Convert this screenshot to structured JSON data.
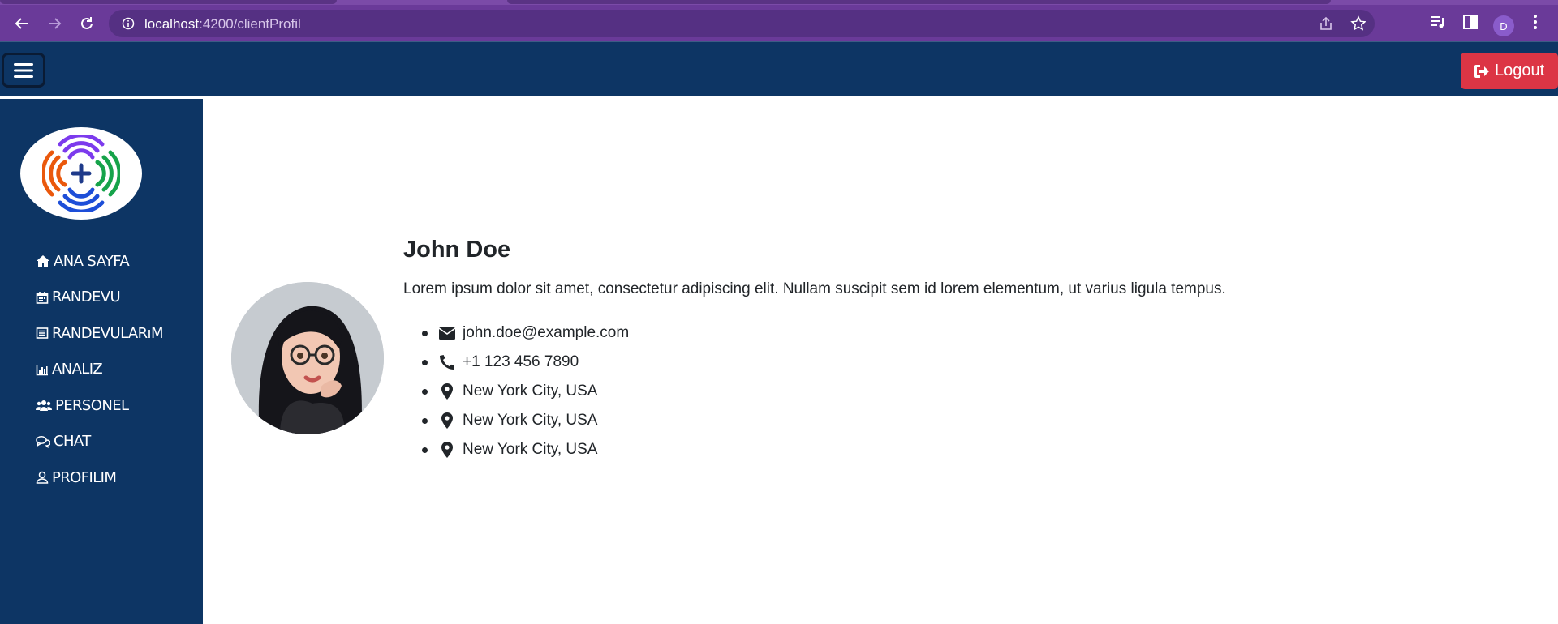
{
  "browser": {
    "url_host": "localhost",
    "url_path": ":4200/clientProfil",
    "profile_initial": "D"
  },
  "header": {
    "logout_label": "Logout"
  },
  "sidebar": {
    "items": [
      {
        "label": "ANA SAYFA",
        "icon": "home-icon"
      },
      {
        "label": "RANDEVU",
        "icon": "calendar-icon"
      },
      {
        "label": "RANDEVULARıM",
        "icon": "list-icon"
      },
      {
        "label": "ANALIZ",
        "icon": "bar-chart-icon"
      },
      {
        "label": "PERSONEL",
        "icon": "users-icon"
      },
      {
        "label": "CHAT",
        "icon": "chat-icon"
      },
      {
        "label": "PROFILIM",
        "icon": "user-icon"
      }
    ]
  },
  "profile": {
    "name": "John Doe",
    "bio": "Lorem ipsum dolor sit amet, consectetur adipiscing elit. Nullam suscipit sem id lorem elementum, ut varius ligula tempus.",
    "email": "john.doe@example.com",
    "phone": "+1 123 456 7890",
    "locations": [
      "New York City, USA",
      "New York City, USA",
      "New York City, USA"
    ]
  },
  "colors": {
    "header_bg": "#0d3564",
    "logout_bg": "#dc3545",
    "chrome_bg": "#6a3a99"
  }
}
